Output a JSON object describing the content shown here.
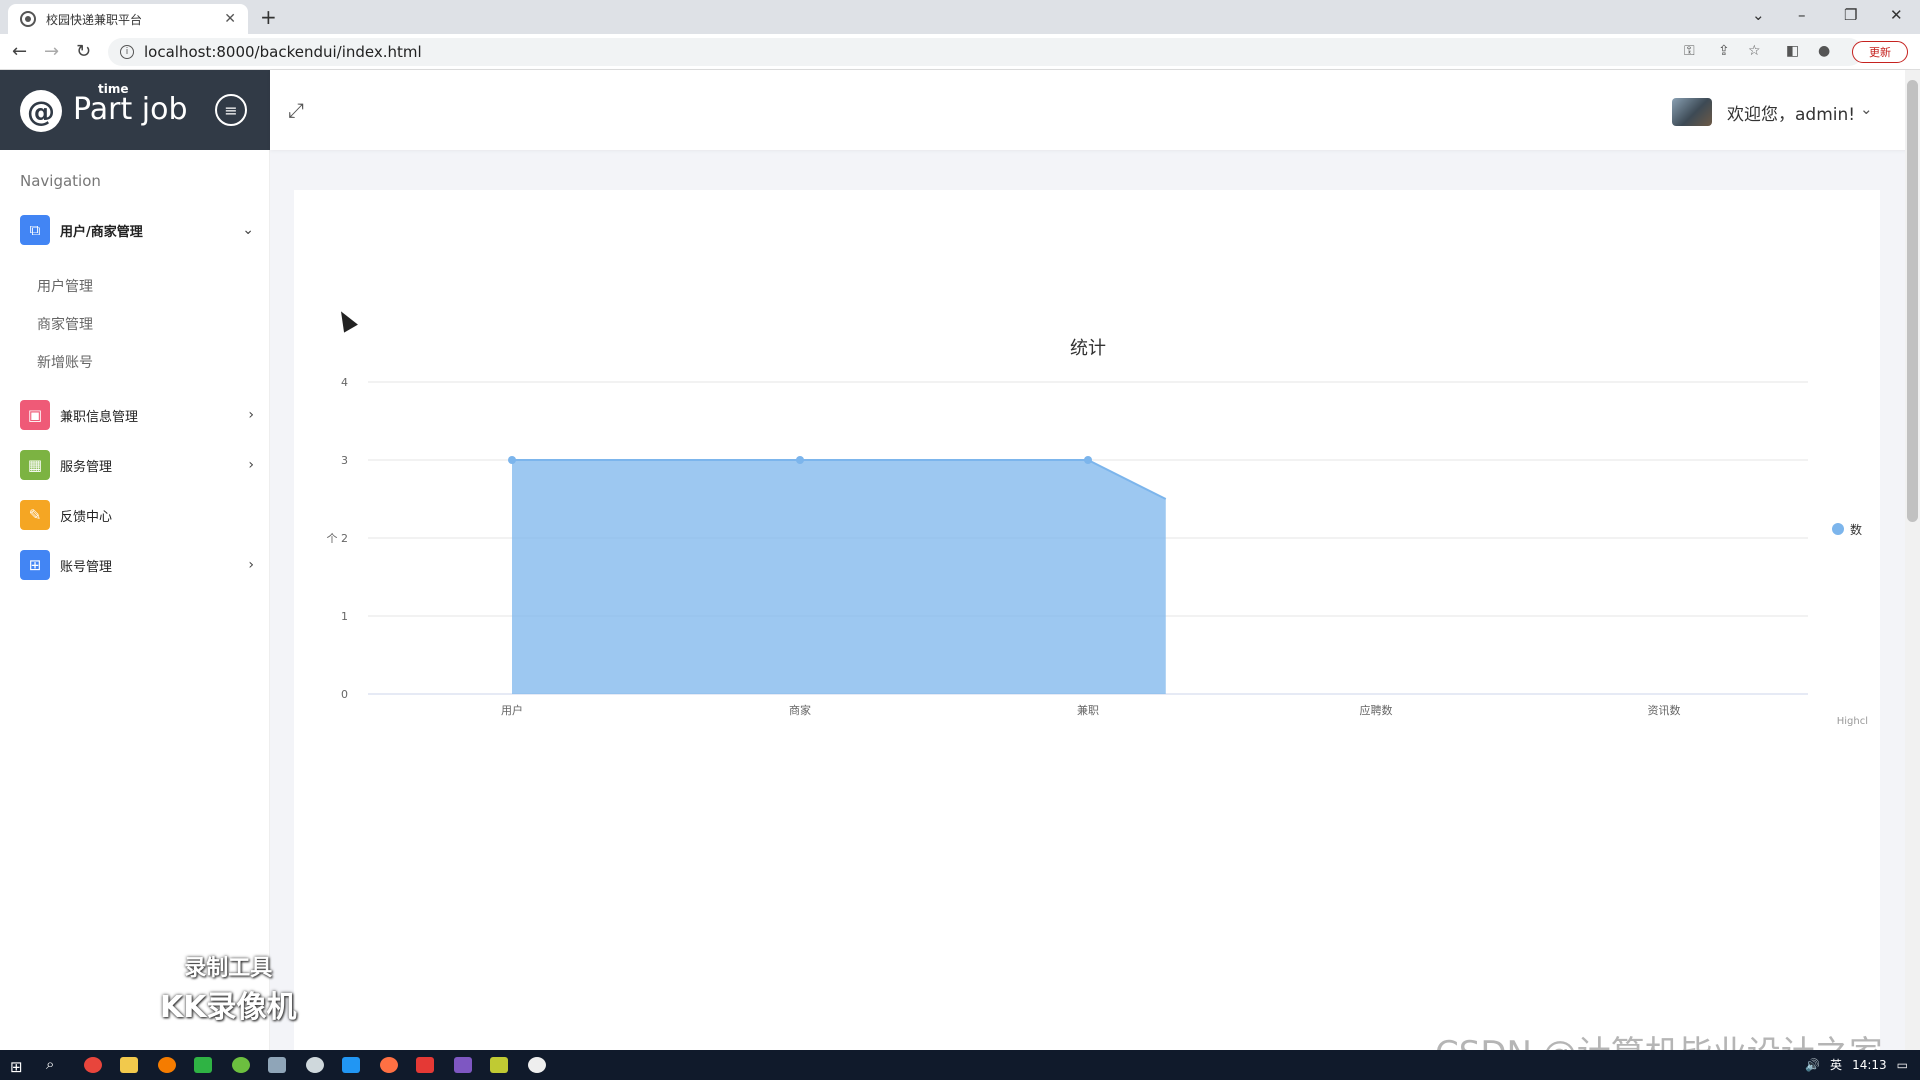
{
  "browser": {
    "tab_title": "校园快递兼职平台",
    "url": "localhost:8000/backendui/index.html",
    "update_label": "更新"
  },
  "brand": {
    "small_text": "time",
    "name": "Part job"
  },
  "sidebar": {
    "nav_label": "Navigation",
    "groups": [
      {
        "label": "用户/商家管理",
        "icon": "users-icon",
        "color": "#4285f4",
        "expanded": true,
        "items": [
          "用户管理",
          "商家管理",
          "新增账号"
        ]
      },
      {
        "label": "兼职信息管理",
        "icon": "calendar-icon",
        "color": "#ef5a77"
      },
      {
        "label": "服务管理",
        "icon": "grid-icon",
        "color": "#7cb342"
      },
      {
        "label": "反馈中心",
        "icon": "edit-icon",
        "color": "#f5a623"
      },
      {
        "label": "账号管理",
        "icon": "apps-icon",
        "color": "#4285f4"
      }
    ]
  },
  "header": {
    "welcome": "欢迎您，admin!"
  },
  "chart_data": {
    "type": "area",
    "title": "统计",
    "categories": [
      "用户",
      "商家",
      "兼职",
      "应聘数",
      "资讯数"
    ],
    "series": [
      {
        "name": "数",
        "values": [
          3,
          3,
          3,
          2.5,
          null
        ]
      }
    ],
    "ylim": [
      0,
      4
    ],
    "yticks": [
      0,
      1,
      2,
      3,
      4
    ],
    "ylabel": "个",
    "color": "#7cb5ec",
    "legend": "right",
    "credit": "Highcl",
    "grid": true
  },
  "watermarks": {
    "recorder_line1": "录制工具",
    "recorder_line2": "KK录像机",
    "csdn": "CSDN @计算机毕业设计之家"
  },
  "taskbar": {
    "time": "14:13",
    "ime": "英"
  }
}
